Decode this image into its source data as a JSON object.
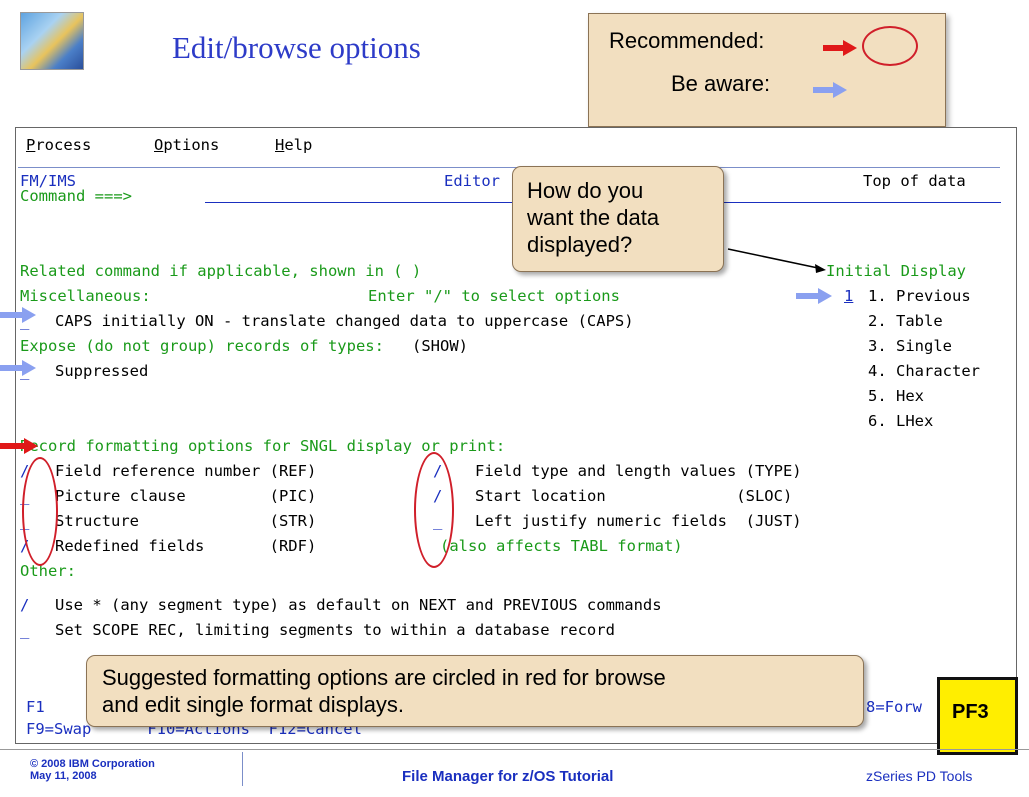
{
  "slide": {
    "title": "Edit/browse options",
    "legend": {
      "recommended_label": "Recommended:",
      "aware_label": "Be aware:",
      "recommended_color": "#d01f2a",
      "aware_color": "#8aa0f0"
    }
  },
  "menu": {
    "items": [
      "Process",
      "Options",
      "Help"
    ]
  },
  "header": {
    "panel_id": "FM/IMS",
    "panel_title": "Editor",
    "position": "Top of data",
    "command_label": "Command ===>"
  },
  "body": {
    "related": "Related command if applicable, shown in ( )",
    "misc": "Miscellaneous:",
    "enter_hint": "Enter \"/\" to select options",
    "initial_display_label": "Initial Display",
    "initial_display_value": "1",
    "caps_line": "CAPS initially ON - translate changed data to uppercase (CAPS)",
    "caps_sel": "_",
    "expose": "Expose (do not group) records of types:",
    "expose_cmd": "(SHOW)",
    "suppressed": "Suppressed",
    "suppressed_sel": "_",
    "display_options": [
      "1. Previous",
      "2. Table",
      "3. Single",
      "4. Character",
      "5. Hex",
      "6. LHex"
    ],
    "record_fmt_heading": "Record formatting options for SNGL display or print:",
    "record_fmt_rows": [
      {
        "sel1": "/",
        "label1": "Field reference number (REF)",
        "sel2": "/",
        "label2": "Field type and length values (TYPE)"
      },
      {
        "sel1": "_",
        "label1": "Picture clause         (PIC)",
        "sel2": "/",
        "label2": "Start location              (SLOC)"
      },
      {
        "sel1": "_",
        "label1": "Structure              (STR)",
        "sel2": "_",
        "label2": "Left justify numeric fields  (JUST)"
      },
      {
        "sel1": "/",
        "label1": "Redefined fields       (RDF)",
        "sel2": "",
        "label2": "(also affects TABL format)"
      }
    ],
    "other_heading": "Other:",
    "other_rows": [
      {
        "sel": "/",
        "label": "Use * (any segment type) as default on NEXT and PREVIOUS commands"
      },
      {
        "sel": "_",
        "label": "Set SCOPE REC, limiting segments to within a database record"
      }
    ]
  },
  "fkeys": {
    "row1_left": "F1",
    "row1_right": "8=Forw",
    "row2": "F9=Swap      F10=Actions  F12=Cancel"
  },
  "tooltips": {
    "how": [
      "How do you",
      "want the data",
      "displayed?"
    ],
    "suggest": [
      "Suggested formatting options are circled in red for browse",
      "and edit single format displays."
    ]
  },
  "pf3": "PF3",
  "footer": {
    "copyright_line1": "© 2008 IBM Corporation",
    "copyright_line2": "May 11, 2008",
    "center": "File Manager for z/OS Tutorial",
    "right": "zSeries PD Tools"
  }
}
